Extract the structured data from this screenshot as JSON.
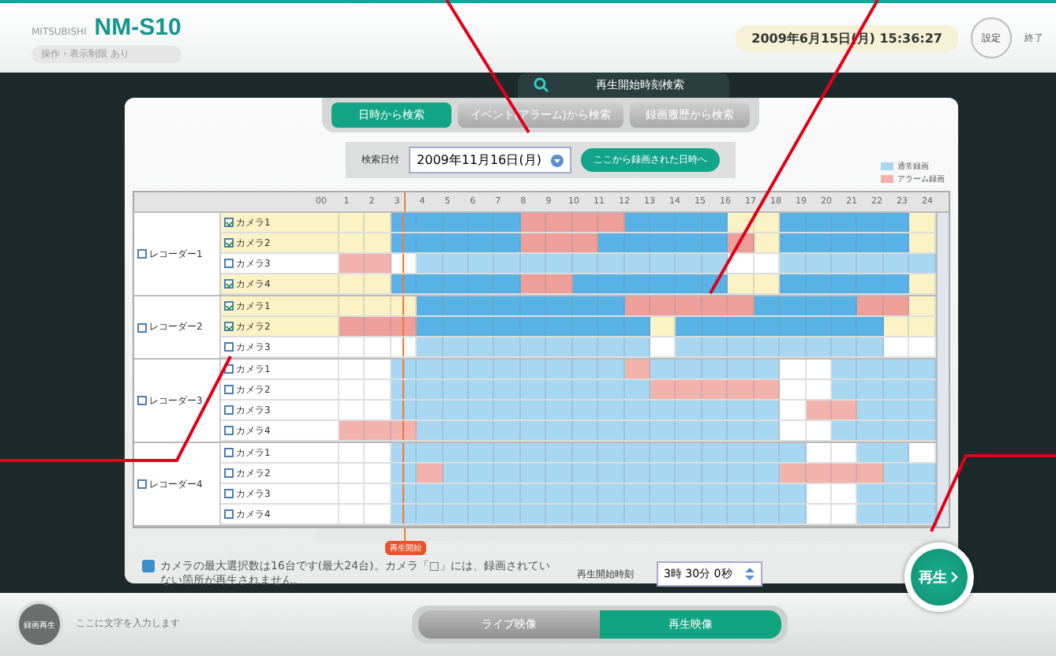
{
  "header": {
    "maker": "MITSUBISHI",
    "product": "NM-S10",
    "subtitle": "操作・表示制限 あり",
    "datetime": "2009年6月15日(月) 15:36:27",
    "settings_button": "設定",
    "exit_button": "終了"
  },
  "screen_title": "再生開始時刻検索",
  "tabs": [
    {
      "label": "日時から検索",
      "selected": true
    },
    {
      "label": "イベント(アラーム)から検索",
      "selected": false
    },
    {
      "label": "録画履歴から検索",
      "selected": false
    }
  ],
  "search": {
    "label": "検索日付",
    "date": "2009年11月16日(月)",
    "jump_button": "ここから録画された日時へ"
  },
  "legend": [
    {
      "label": "通常録画",
      "kind": "normal"
    },
    {
      "label": "アラーム録画",
      "kind": "alarm"
    }
  ],
  "hours": [
    "00",
    "1",
    "2",
    "3",
    "4",
    "5",
    "6",
    "7",
    "8",
    "9",
    "10",
    "11",
    "12",
    "13",
    "14",
    "15",
    "16",
    "17",
    "18",
    "19",
    "20",
    "21",
    "22",
    "23",
    "24"
  ],
  "recorders": [
    {
      "name": "レコーダー1",
      "checked": false,
      "cameras": [
        {
          "name": "カメラ1",
          "checked": true,
          "cells": [
            {
              "kind": "none"
            },
            {
              "kind": "none"
            },
            {
              "kind": "none"
            },
            {
              "kind": "normal"
            },
            {
              "kind": "normal"
            },
            {
              "kind": "normal"
            },
            {
              "kind": "normal"
            },
            {
              "kind": "normal"
            },
            {
              "kind": "alarm"
            },
            {
              "kind": "alarm"
            },
            {
              "kind": "alarm"
            },
            {
              "kind": "alarm"
            },
            {
              "kind": "normal"
            },
            {
              "kind": "normal"
            },
            {
              "kind": "normal"
            },
            {
              "kind": "normal"
            },
            {
              "kind": "none"
            },
            {
              "kind": "none"
            },
            {
              "kind": "normal"
            },
            {
              "kind": "normal"
            },
            {
              "kind": "normal"
            },
            {
              "kind": "normal"
            },
            {
              "kind": "normal"
            },
            {
              "kind": "none"
            }
          ]
        },
        {
          "name": "カメラ2",
          "checked": true,
          "cells": [
            {
              "kind": "none"
            },
            {
              "kind": "none"
            },
            {
              "kind": "none"
            },
            {
              "kind": "normal"
            },
            {
              "kind": "normal"
            },
            {
              "kind": "normal"
            },
            {
              "kind": "normal"
            },
            {
              "kind": "normal"
            },
            {
              "kind": "alarm"
            },
            {
              "kind": "alarm"
            },
            {
              "kind": "alarm"
            },
            {
              "kind": "normal"
            },
            {
              "kind": "normal"
            },
            {
              "kind": "normal"
            },
            {
              "kind": "normal"
            },
            {
              "kind": "normal"
            },
            {
              "kind": "alarm"
            },
            {
              "kind": "none"
            },
            {
              "kind": "normal"
            },
            {
              "kind": "normal"
            },
            {
              "kind": "normal"
            },
            {
              "kind": "normal"
            },
            {
              "kind": "normal"
            },
            {
              "kind": "none"
            }
          ]
        },
        {
          "name": "カメラ3",
          "checked": false,
          "cells": [
            {
              "kind": "none"
            },
            {
              "kind": "alarm"
            },
            {
              "kind": "alarm"
            },
            {
              "kind": "none"
            },
            {
              "kind": "normal"
            },
            {
              "kind": "normal"
            },
            {
              "kind": "normal"
            },
            {
              "kind": "normal"
            },
            {
              "kind": "normal"
            },
            {
              "kind": "normal"
            },
            {
              "kind": "normal"
            },
            {
              "kind": "normal"
            },
            {
              "kind": "normal"
            },
            {
              "kind": "normal"
            },
            {
              "kind": "normal"
            },
            {
              "kind": "normal"
            },
            {
              "kind": "none"
            },
            {
              "kind": "none"
            },
            {
              "kind": "normal"
            },
            {
              "kind": "normal"
            },
            {
              "kind": "normal"
            },
            {
              "kind": "normal"
            },
            {
              "kind": "normal"
            },
            {
              "kind": "normal"
            }
          ]
        },
        {
          "name": "カメラ4",
          "checked": true,
          "cells": [
            {
              "kind": "none"
            },
            {
              "kind": "none"
            },
            {
              "kind": "none"
            },
            {
              "kind": "normal"
            },
            {
              "kind": "normal"
            },
            {
              "kind": "normal"
            },
            {
              "kind": "normal"
            },
            {
              "kind": "normal"
            },
            {
              "kind": "alarm"
            },
            {
              "kind": "alarm"
            },
            {
              "kind": "normal"
            },
            {
              "kind": "normal"
            },
            {
              "kind": "normal"
            },
            {
              "kind": "normal"
            },
            {
              "kind": "normal"
            },
            {
              "kind": "normal"
            },
            {
              "kind": "none"
            },
            {
              "kind": "none"
            },
            {
              "kind": "normal"
            },
            {
              "kind": "normal"
            },
            {
              "kind": "normal"
            },
            {
              "kind": "normal"
            },
            {
              "kind": "normal"
            },
            {
              "kind": "none"
            }
          ]
        }
      ]
    },
    {
      "name": "レコーダー2",
      "checked": false,
      "cameras": [
        {
          "name": "カメラ1",
          "checked": true,
          "cells": [
            {
              "kind": "none"
            },
            {
              "kind": "none"
            },
            {
              "kind": "none"
            },
            {
              "kind": "none"
            },
            {
              "kind": "normal"
            },
            {
              "kind": "normal"
            },
            {
              "kind": "normal"
            },
            {
              "kind": "normal"
            },
            {
              "kind": "normal"
            },
            {
              "kind": "normal"
            },
            {
              "kind": "normal"
            },
            {
              "kind": "normal"
            },
            {
              "kind": "alarm"
            },
            {
              "kind": "alarm"
            },
            {
              "kind": "alarm"
            },
            {
              "kind": "alarm"
            },
            {
              "kind": "alarm"
            },
            {
              "kind": "normal"
            },
            {
              "kind": "normal"
            },
            {
              "kind": "normal"
            },
            {
              "kind": "normal"
            },
            {
              "kind": "alarm"
            },
            {
              "kind": "alarm"
            },
            {
              "kind": "none"
            }
          ]
        },
        {
          "name": "カメラ2",
          "checked": true,
          "cells": [
            {
              "kind": "none"
            },
            {
              "kind": "alarm"
            },
            {
              "kind": "alarm"
            },
            {
              "kind": "alarm"
            },
            {
              "kind": "normal"
            },
            {
              "kind": "normal"
            },
            {
              "kind": "normal"
            },
            {
              "kind": "normal"
            },
            {
              "kind": "normal"
            },
            {
              "kind": "normal"
            },
            {
              "kind": "normal"
            },
            {
              "kind": "normal"
            },
            {
              "kind": "normal"
            },
            {
              "kind": "none"
            },
            {
              "kind": "normal"
            },
            {
              "kind": "normal"
            },
            {
              "kind": "normal"
            },
            {
              "kind": "normal"
            },
            {
              "kind": "normal"
            },
            {
              "kind": "normal"
            },
            {
              "kind": "normal"
            },
            {
              "kind": "normal"
            },
            {
              "kind": "none"
            },
            {
              "kind": "none"
            }
          ]
        },
        {
          "name": "カメラ3",
          "checked": false,
          "cells": [
            {
              "kind": "none"
            },
            {
              "kind": "none"
            },
            {
              "kind": "none"
            },
            {
              "kind": "none"
            },
            {
              "kind": "normal"
            },
            {
              "kind": "normal"
            },
            {
              "kind": "normal"
            },
            {
              "kind": "normal"
            },
            {
              "kind": "normal"
            },
            {
              "kind": "normal"
            },
            {
              "kind": "normal"
            },
            {
              "kind": "normal"
            },
            {
              "kind": "normal"
            },
            {
              "kind": "none"
            },
            {
              "kind": "normal"
            },
            {
              "kind": "normal"
            },
            {
              "kind": "normal"
            },
            {
              "kind": "normal"
            },
            {
              "kind": "normal"
            },
            {
              "kind": "normal"
            },
            {
              "kind": "normal"
            },
            {
              "kind": "normal"
            },
            {
              "kind": "none"
            },
            {
              "kind": "none"
            }
          ]
        }
      ]
    },
    {
      "name": "レコーダー3",
      "checked": false,
      "cameras": [
        {
          "name": "カメラ1",
          "checked": false,
          "cells": [
            {
              "kind": "none"
            },
            {
              "kind": "none"
            },
            {
              "kind": "none"
            },
            {
              "kind": "normal"
            },
            {
              "kind": "normal"
            },
            {
              "kind": "normal"
            },
            {
              "kind": "normal"
            },
            {
              "kind": "normal"
            },
            {
              "kind": "normal"
            },
            {
              "kind": "normal"
            },
            {
              "kind": "normal"
            },
            {
              "kind": "normal"
            },
            {
              "kind": "alarm"
            },
            {
              "kind": "normal"
            },
            {
              "kind": "normal"
            },
            {
              "kind": "normal"
            },
            {
              "kind": "normal"
            },
            {
              "kind": "normal"
            },
            {
              "kind": "none"
            },
            {
              "kind": "none"
            },
            {
              "kind": "normal"
            },
            {
              "kind": "normal"
            },
            {
              "kind": "normal"
            },
            {
              "kind": "normal"
            }
          ]
        },
        {
          "name": "カメラ2",
          "checked": false,
          "cells": [
            {
              "kind": "none"
            },
            {
              "kind": "none"
            },
            {
              "kind": "none"
            },
            {
              "kind": "normal"
            },
            {
              "kind": "normal"
            },
            {
              "kind": "normal"
            },
            {
              "kind": "normal"
            },
            {
              "kind": "normal"
            },
            {
              "kind": "normal"
            },
            {
              "kind": "normal"
            },
            {
              "kind": "normal"
            },
            {
              "kind": "normal"
            },
            {
              "kind": "normal"
            },
            {
              "kind": "alarm"
            },
            {
              "kind": "alarm"
            },
            {
              "kind": "alarm"
            },
            {
              "kind": "alarm"
            },
            {
              "kind": "alarm"
            },
            {
              "kind": "none"
            },
            {
              "kind": "none"
            },
            {
              "kind": "normal"
            },
            {
              "kind": "normal"
            },
            {
              "kind": "normal"
            },
            {
              "kind": "normal"
            }
          ]
        },
        {
          "name": "カメラ3",
          "checked": false,
          "cells": [
            {
              "kind": "none"
            },
            {
              "kind": "none"
            },
            {
              "kind": "none"
            },
            {
              "kind": "normal"
            },
            {
              "kind": "normal"
            },
            {
              "kind": "normal"
            },
            {
              "kind": "normal"
            },
            {
              "kind": "normal"
            },
            {
              "kind": "normal"
            },
            {
              "kind": "normal"
            },
            {
              "kind": "normal"
            },
            {
              "kind": "normal"
            },
            {
              "kind": "normal"
            },
            {
              "kind": "normal"
            },
            {
              "kind": "normal"
            },
            {
              "kind": "normal"
            },
            {
              "kind": "normal"
            },
            {
              "kind": "normal"
            },
            {
              "kind": "none"
            },
            {
              "kind": "alarm"
            },
            {
              "kind": "alarm"
            },
            {
              "kind": "normal"
            },
            {
              "kind": "normal"
            },
            {
              "kind": "normal"
            }
          ]
        },
        {
          "name": "カメラ4",
          "checked": false,
          "cells": [
            {
              "kind": "none"
            },
            {
              "kind": "alarm"
            },
            {
              "kind": "alarm"
            },
            {
              "kind": "alarm"
            },
            {
              "kind": "normal"
            },
            {
              "kind": "normal"
            },
            {
              "kind": "normal"
            },
            {
              "kind": "normal"
            },
            {
              "kind": "normal"
            },
            {
              "kind": "normal"
            },
            {
              "kind": "normal"
            },
            {
              "kind": "normal"
            },
            {
              "kind": "normal"
            },
            {
              "kind": "normal"
            },
            {
              "kind": "normal"
            },
            {
              "kind": "normal"
            },
            {
              "kind": "normal"
            },
            {
              "kind": "normal"
            },
            {
              "kind": "none"
            },
            {
              "kind": "none"
            },
            {
              "kind": "normal"
            },
            {
              "kind": "normal"
            },
            {
              "kind": "normal"
            },
            {
              "kind": "normal"
            }
          ]
        }
      ]
    },
    {
      "name": "レコーダー4",
      "checked": false,
      "cameras": [
        {
          "name": "カメラ1",
          "checked": false,
          "cells": [
            {
              "kind": "none"
            },
            {
              "kind": "none"
            },
            {
              "kind": "none"
            },
            {
              "kind": "normal"
            },
            {
              "kind": "normal"
            },
            {
              "kind": "normal"
            },
            {
              "kind": "normal"
            },
            {
              "kind": "normal"
            },
            {
              "kind": "normal"
            },
            {
              "kind": "normal"
            },
            {
              "kind": "normal"
            },
            {
              "kind": "normal"
            },
            {
              "kind": "normal"
            },
            {
              "kind": "normal"
            },
            {
              "kind": "normal"
            },
            {
              "kind": "normal"
            },
            {
              "kind": "normal"
            },
            {
              "kind": "normal"
            },
            {
              "kind": "normal"
            },
            {
              "kind": "none"
            },
            {
              "kind": "none"
            },
            {
              "kind": "normal"
            },
            {
              "kind": "normal"
            },
            {
              "kind": "none"
            }
          ]
        },
        {
          "name": "カメラ2",
          "checked": false,
          "cells": [
            {
              "kind": "none"
            },
            {
              "kind": "none"
            },
            {
              "kind": "none"
            },
            {
              "kind": "normal"
            },
            {
              "kind": "alarm"
            },
            {
              "kind": "normal"
            },
            {
              "kind": "normal"
            },
            {
              "kind": "normal"
            },
            {
              "kind": "normal"
            },
            {
              "kind": "normal"
            },
            {
              "kind": "normal"
            },
            {
              "kind": "normal"
            },
            {
              "kind": "normal"
            },
            {
              "kind": "normal"
            },
            {
              "kind": "normal"
            },
            {
              "kind": "normal"
            },
            {
              "kind": "normal"
            },
            {
              "kind": "normal"
            },
            {
              "kind": "alarm"
            },
            {
              "kind": "alarm"
            },
            {
              "kind": "alarm"
            },
            {
              "kind": "alarm"
            },
            {
              "kind": "normal"
            },
            {
              "kind": "normal"
            }
          ]
        },
        {
          "name": "カメラ3",
          "checked": false,
          "cells": [
            {
              "kind": "none"
            },
            {
              "kind": "none"
            },
            {
              "kind": "none"
            },
            {
              "kind": "normal"
            },
            {
              "kind": "normal"
            },
            {
              "kind": "normal"
            },
            {
              "kind": "normal"
            },
            {
              "kind": "normal"
            },
            {
              "kind": "normal"
            },
            {
              "kind": "normal"
            },
            {
              "kind": "normal"
            },
            {
              "kind": "normal"
            },
            {
              "kind": "normal"
            },
            {
              "kind": "normal"
            },
            {
              "kind": "normal"
            },
            {
              "kind": "normal"
            },
            {
              "kind": "normal"
            },
            {
              "kind": "normal"
            },
            {
              "kind": "normal"
            },
            {
              "kind": "none"
            },
            {
              "kind": "none"
            },
            {
              "kind": "normal"
            },
            {
              "kind": "normal"
            },
            {
              "kind": "normal"
            }
          ]
        },
        {
          "name": "カメラ4",
          "checked": false,
          "cells": [
            {
              "kind": "none"
            },
            {
              "kind": "none"
            },
            {
              "kind": "none"
            },
            {
              "kind": "normal"
            },
            {
              "kind": "normal"
            },
            {
              "kind": "normal"
            },
            {
              "kind": "normal"
            },
            {
              "kind": "normal"
            },
            {
              "kind": "normal"
            },
            {
              "kind": "normal"
            },
            {
              "kind": "normal"
            },
            {
              "kind": "normal"
            },
            {
              "kind": "normal"
            },
            {
              "kind": "normal"
            },
            {
              "kind": "normal"
            },
            {
              "kind": "normal"
            },
            {
              "kind": "normal"
            },
            {
              "kind": "normal"
            },
            {
              "kind": "normal"
            },
            {
              "kind": "none"
            },
            {
              "kind": "none"
            },
            {
              "kind": "normal"
            },
            {
              "kind": "normal"
            },
            {
              "kind": "normal"
            }
          ]
        }
      ]
    }
  ],
  "start_marker": {
    "label": "再生開始",
    "level": 0.146
  },
  "note": "カメラの最大選択数は16台です(最大24台)。カメラ「□」には、録画されていない箇所が再生されません。",
  "start_time": {
    "label": "再生開始時刻",
    "value": "3時 30分 0秒"
  },
  "play_button": "再生",
  "footer": {
    "record_button": "録画再生",
    "input_placeholder": "ここに文字を入力します",
    "tabs": [
      {
        "label": "ライブ映像",
        "selected": false
      },
      {
        "label": "再生映像",
        "selected": true
      }
    ]
  }
}
